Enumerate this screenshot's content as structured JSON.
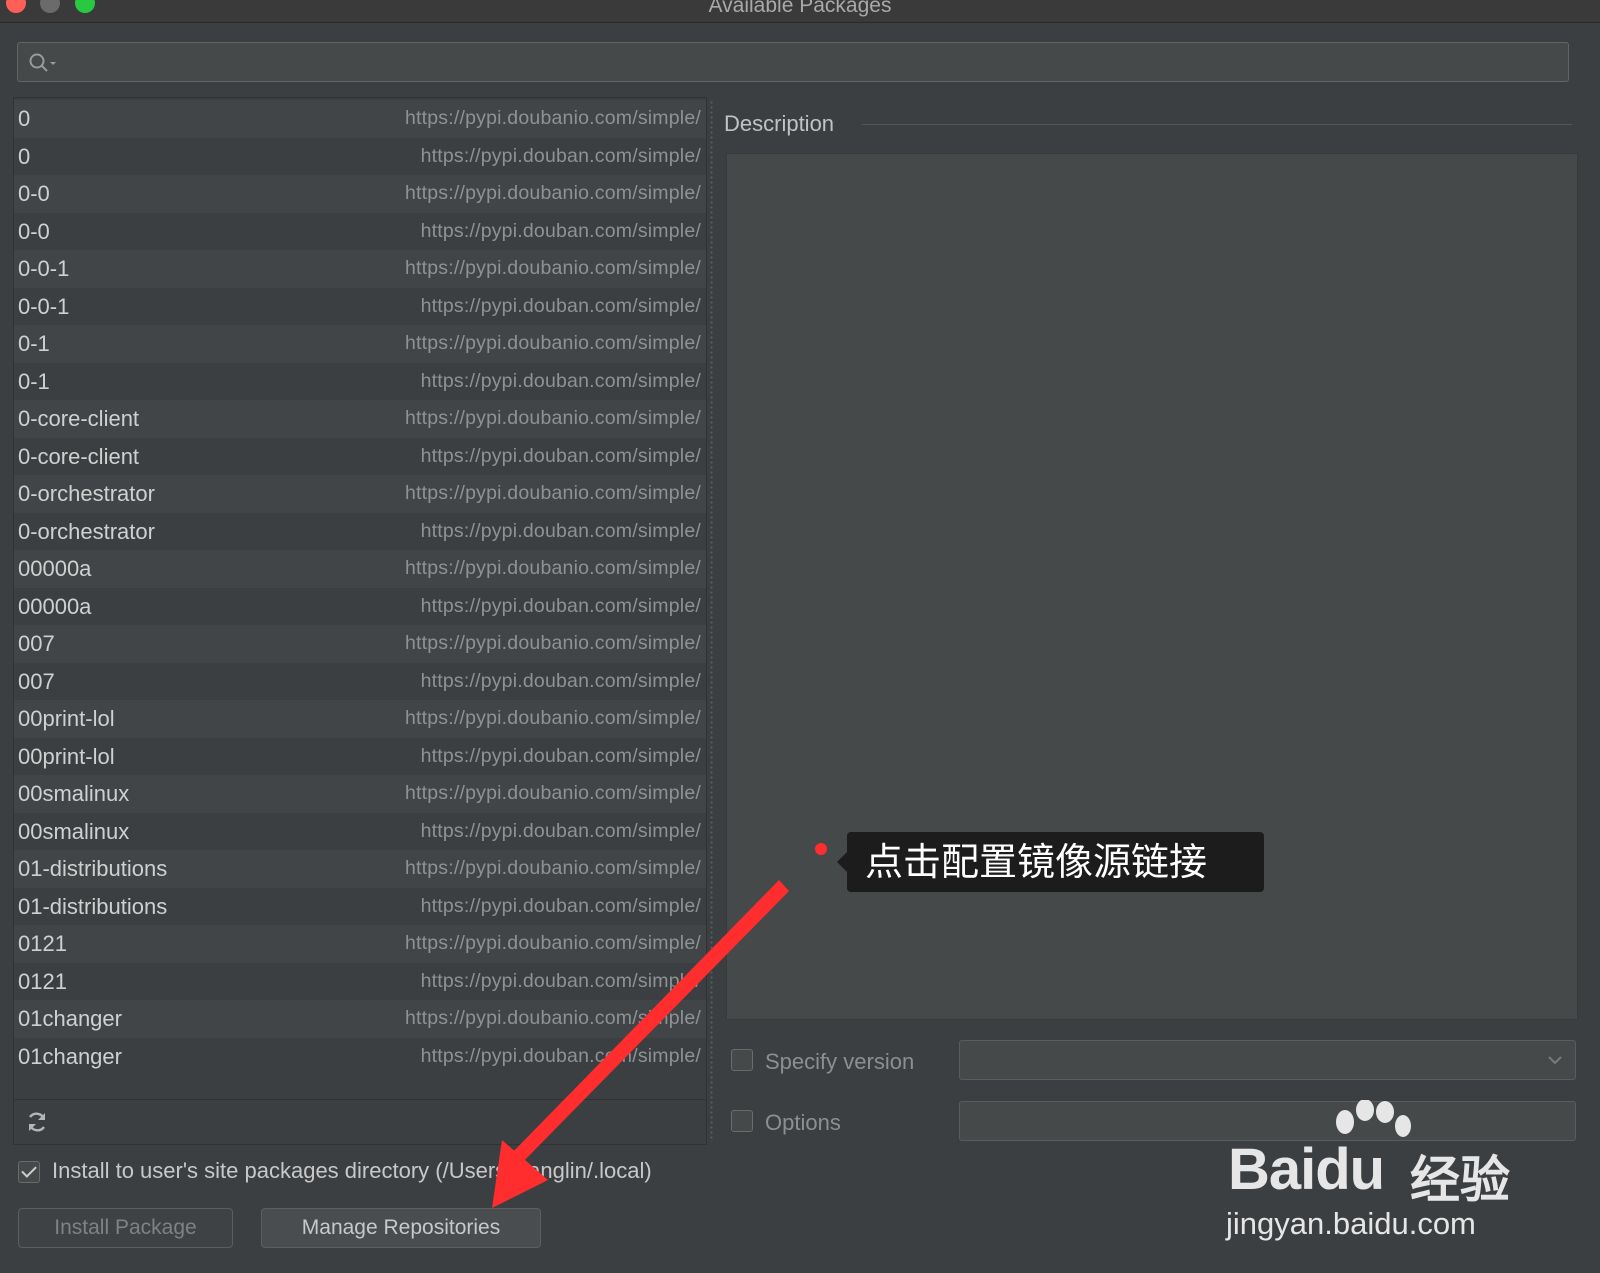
{
  "window": {
    "title": "Available Packages"
  },
  "search": {
    "value": "",
    "placeholder": ""
  },
  "packages": [
    {
      "name": "0",
      "repo": "https://pypi.doubanio.com/simple/"
    },
    {
      "name": "0",
      "repo": "https://pypi.douban.com/simple/"
    },
    {
      "name": "0-0",
      "repo": "https://pypi.doubanio.com/simple/"
    },
    {
      "name": "0-0",
      "repo": "https://pypi.douban.com/simple/"
    },
    {
      "name": "0-0-1",
      "repo": "https://pypi.doubanio.com/simple/"
    },
    {
      "name": "0-0-1",
      "repo": "https://pypi.douban.com/simple/"
    },
    {
      "name": "0-1",
      "repo": "https://pypi.doubanio.com/simple/"
    },
    {
      "name": "0-1",
      "repo": "https://pypi.douban.com/simple/"
    },
    {
      "name": "0-core-client",
      "repo": "https://pypi.doubanio.com/simple/"
    },
    {
      "name": "0-core-client",
      "repo": "https://pypi.douban.com/simple/"
    },
    {
      "name": "0-orchestrator",
      "repo": "https://pypi.doubanio.com/simple/"
    },
    {
      "name": "0-orchestrator",
      "repo": "https://pypi.douban.com/simple/"
    },
    {
      "name": "00000a",
      "repo": "https://pypi.doubanio.com/simple/"
    },
    {
      "name": "00000a",
      "repo": "https://pypi.douban.com/simple/"
    },
    {
      "name": "007",
      "repo": "https://pypi.doubanio.com/simple/"
    },
    {
      "name": "007",
      "repo": "https://pypi.douban.com/simple/"
    },
    {
      "name": "00print-lol",
      "repo": "https://pypi.doubanio.com/simple/"
    },
    {
      "name": "00print-lol",
      "repo": "https://pypi.douban.com/simple/"
    },
    {
      "name": "00smalinux",
      "repo": "https://pypi.doubanio.com/simple/"
    },
    {
      "name": "00smalinux",
      "repo": "https://pypi.douban.com/simple/"
    },
    {
      "name": "01-distributions",
      "repo": "https://pypi.doubanio.com/simple/"
    },
    {
      "name": "01-distributions",
      "repo": "https://pypi.douban.com/simple/"
    },
    {
      "name": "0121",
      "repo": "https://pypi.doubanio.com/simple/"
    },
    {
      "name": "0121",
      "repo": "https://pypi.douban.com/simple/"
    },
    {
      "name": "01changer",
      "repo": "https://pypi.doubanio.com/simple/"
    },
    {
      "name": "01changer",
      "repo": "https://pypi.douban.com/simple/"
    }
  ],
  "description": {
    "label": "Description",
    "text": ""
  },
  "options": {
    "specify_version_label": "Specify version",
    "specify_version_checked": false,
    "version_value": "",
    "options_label": "Options",
    "options_checked": false,
    "options_value": "",
    "install_to_user_label": "Install to user's site packages directory (/Users/wanglin/.local)",
    "install_to_user_checked": true
  },
  "buttons": {
    "install": "Install Package",
    "manage": "Manage Repositories"
  },
  "annotation": {
    "text": "点击配置镜像源链接",
    "accent": "#ff2d2d"
  },
  "watermark": {
    "brand": "Baidu",
    "brand_cn": "经验",
    "domain": "jingyan.baidu.com"
  },
  "icons": {
    "search": "search-icon",
    "refresh": "refresh-icon",
    "dropdown": "chevron-down-icon"
  },
  "colors": {
    "background": "#3c3f41",
    "arrow": "#ff2d2d"
  }
}
